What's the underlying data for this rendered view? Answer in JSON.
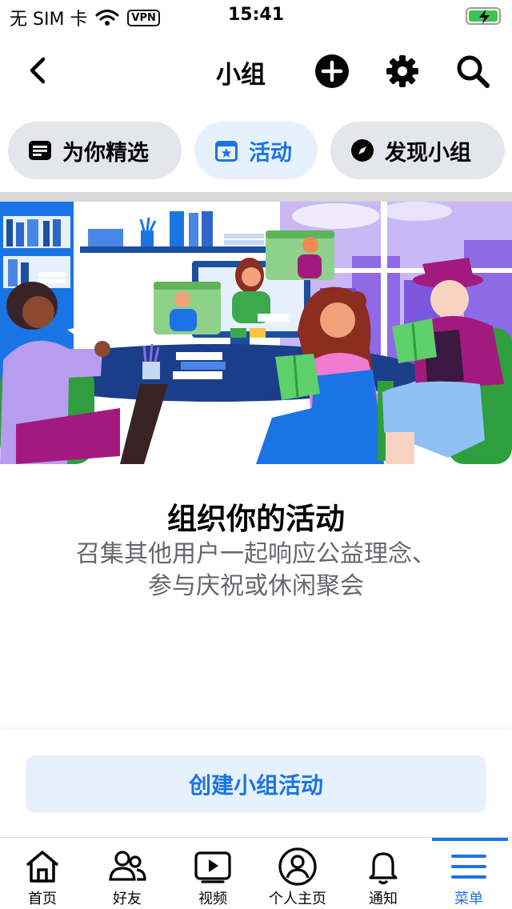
{
  "status_bar": {
    "carrier": "无 SIM 卡",
    "vpn": "VPN",
    "time": "15:41"
  },
  "nav": {
    "title": "小组"
  },
  "chips": [
    {
      "label": "为你精选",
      "icon": "feed-icon"
    },
    {
      "label": "活动",
      "icon": "calendar-star-icon"
    },
    {
      "label": "发现小组",
      "icon": "compass-icon"
    }
  ],
  "content": {
    "headline": "组织你的活动",
    "subline_1": "召集其他用户一起响应公益理念、",
    "subline_2": "参与庆祝或休闲聚会"
  },
  "cta": {
    "label": "创建小组活动"
  },
  "tabbar": {
    "tabs": [
      {
        "label": "首页",
        "icon": "home-icon"
      },
      {
        "label": "好友",
        "icon": "friends-icon"
      },
      {
        "label": "视频",
        "icon": "video-icon"
      },
      {
        "label": "个人主页",
        "icon": "profile-icon"
      },
      {
        "label": "通知",
        "icon": "bell-icon"
      },
      {
        "label": "菜单",
        "icon": "menu-icon"
      }
    ],
    "active": "菜单"
  },
  "colors": {
    "accent": "#1b74e4",
    "chip_bg": "#e4e6eb",
    "active_chip_bg": "#e7f1fd"
  }
}
